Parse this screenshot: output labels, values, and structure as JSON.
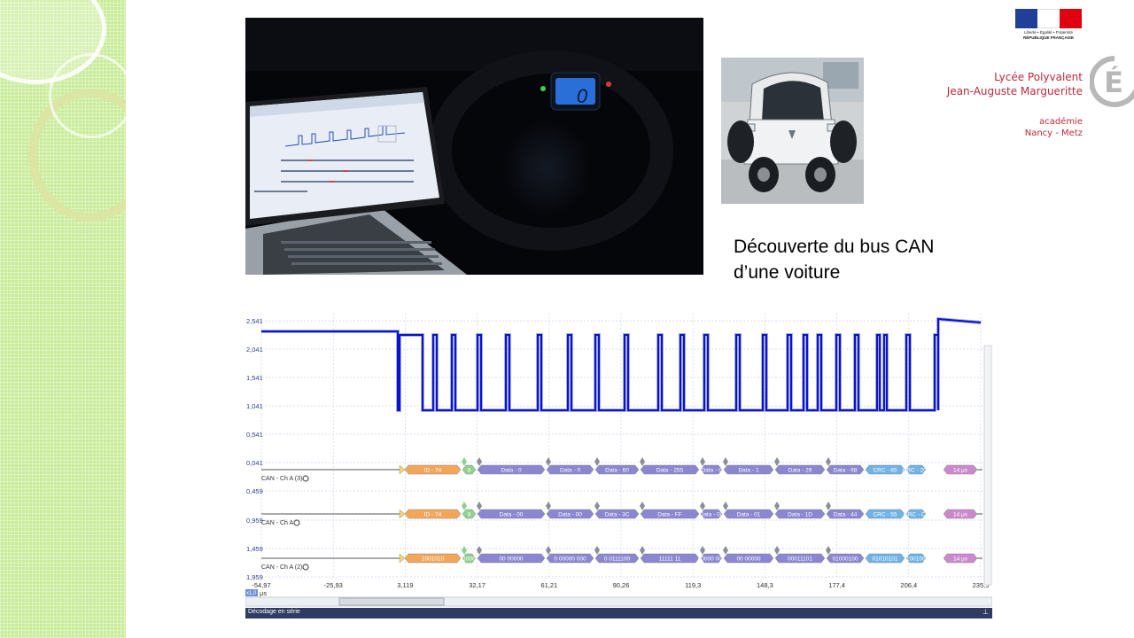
{
  "caption": {
    "line1": "Découverte du bus CAN",
    "line2": "d’une voiture"
  },
  "logo": {
    "motto": "Liberté • Égalité • Fraternité",
    "republic": "RÉPUBLIQUE FRANÇAISE",
    "school_line1": "Lycée Polyvalent",
    "school_line2": "Jean-Auguste Margueritte",
    "academie_line1": "académie",
    "academie_line2": "Nancy - Metz",
    "badge_letter": "É",
    "colors": {
      "flag_blue": "#1f3f99",
      "flag_red": "#e1000f",
      "school_red": "#c0283a"
    }
  },
  "photos": {
    "laptop": {
      "dashboard_speed": "0"
    },
    "car": {}
  },
  "scope": {
    "y_labels": [
      "2,541",
      "2,041",
      "1,541",
      "1,041",
      "0,541",
      "0,041",
      "0,459",
      "0,959",
      "1,459",
      "1,959"
    ],
    "x_labels": [
      "-54,97",
      "-25,93",
      "3,119",
      "32,17",
      "61,21",
      "90,26",
      "119,3",
      "148,3",
      "177,4",
      "206,4",
      "235,5"
    ],
    "x_unit": "μs",
    "zoom_label": "x1,0",
    "channel_labels": [
      "CAN - Ch A (3)",
      "CAN - Ch A",
      "CAN - Ch A (2)"
    ],
    "decode_rows": [
      [
        "ID - 74",
        "8",
        "Data - 0",
        "Data - 0",
        "Data - 60",
        "Data - 255",
        "Data - 0",
        "Data - 1",
        "Data - 29",
        "Data - 68",
        "CRC - 85",
        "CRC - 201",
        "14 μs"
      ],
      [
        "ID - 74",
        "8",
        "Data - 00",
        "Data - 00",
        "Data - 3C",
        "Data - FF",
        "Data - 00",
        "Data - 01",
        "Data - 1D",
        "Data - 44",
        "CRC - 55",
        "CRC - C9",
        "14 μs"
      ],
      [
        "1001010",
        "1000",
        "00 00000",
        "0 00000 000",
        "0 0111100",
        "11111 11",
        "00000 000",
        "00 00000",
        "00011101",
        "01000100",
        "01010101",
        "11001001",
        "14 μs"
      ]
    ],
    "colors": {
      "trace": "#0a14c8",
      "id": "#f2a65a",
      "dlc": "#8fd18f",
      "data": "#8b86d0",
      "crc": "#6fb3e6",
      "eof": "#cc88cc"
    },
    "decode_bar_label": "Décodage en série",
    "decode_bar_pin": "⊥"
  }
}
